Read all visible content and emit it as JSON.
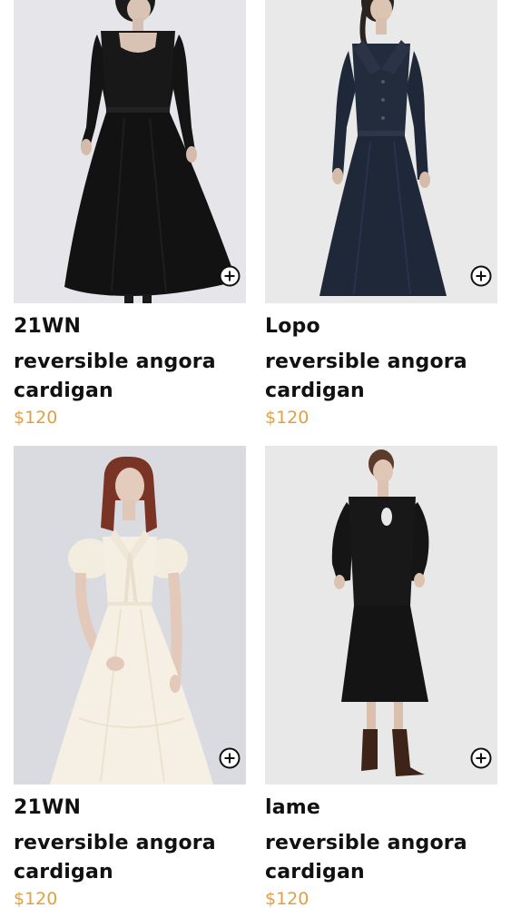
{
  "products": [
    {
      "brand": "21WN",
      "name": "reversible angora cardigan",
      "price": "$120",
      "image": "black-square-neck-dress-photo",
      "add_icon": "plus-circle-icon"
    },
    {
      "brand": "Lopo",
      "name": "reversible angora cardigan",
      "price": "$120",
      "image": "navy-collared-coat-dress-photo",
      "add_icon": "plus-circle-icon"
    },
    {
      "brand": "21WN",
      "name": "reversible angora cardigan",
      "price": "$120",
      "image": "ivory-bow-dress-photo",
      "add_icon": "plus-circle-icon"
    },
    {
      "brand": "lame",
      "name": "reversible angora cardigan",
      "price": "$120",
      "image": "black-keyhole-midi-dress-photo",
      "add_icon": "plus-circle-icon"
    }
  ],
  "colors": {
    "price": "#e0a040",
    "text": "#111111"
  }
}
